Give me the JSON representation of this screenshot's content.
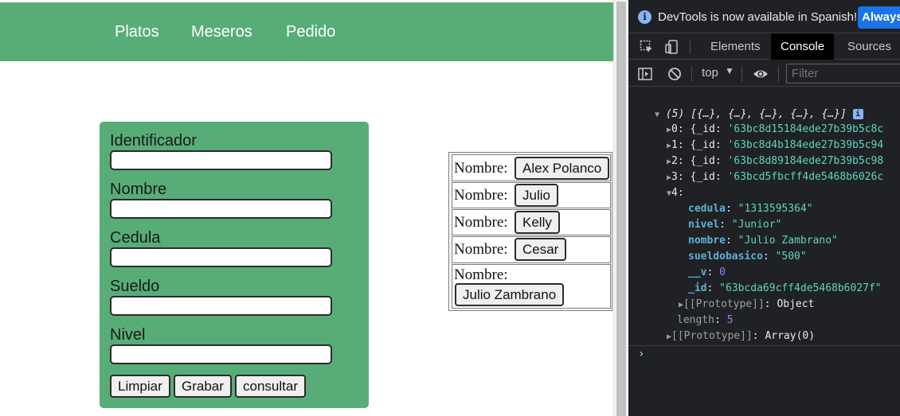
{
  "nav": {
    "platos": "Platos",
    "meseros": "Meseros",
    "pedido": "Pedido"
  },
  "form": {
    "fields": [
      {
        "label": "Identificador",
        "value": ""
      },
      {
        "label": "Nombre",
        "value": ""
      },
      {
        "label": "Cedula",
        "value": ""
      },
      {
        "label": "Sueldo",
        "value": ""
      },
      {
        "label": "Nivel",
        "value": ""
      }
    ],
    "buttons": {
      "clear": "Limpiar",
      "save": "Grabar",
      "query": "consultar"
    }
  },
  "names_table": {
    "row_label": "Nombre:",
    "rows": [
      "Alex Polanco",
      "Julio",
      "Kelly",
      "Cesar",
      "Julio Zambrano"
    ]
  },
  "devtools": {
    "info_text": "DevTools is now available in Spanish!",
    "always_button": "Always",
    "tabs": [
      "Elements",
      "Console",
      "Sources"
    ],
    "active_tab": "Console",
    "context": "top",
    "filter_placeholder": "Filter",
    "console": {
      "array_summary": "(5) [{…}, {…}, {…}, {…}, {…}]",
      "info_badge": "i",
      "items": [
        {
          "index": "0:",
          "preview": "{_id: ",
          "id": "'63bc8d15184ede27b39b5c8c"
        },
        {
          "index": "1:",
          "preview": "{_id: ",
          "id": "'63bc8d4b184ede27b39b5c94"
        },
        {
          "index": "2:",
          "preview": "{_id: ",
          "id": "'63bc8d89184ede27b39b5c98"
        },
        {
          "index": "3:",
          "preview": "{_id: ",
          "id": "'63bcd5fbcff4de5468b6026c"
        }
      ],
      "expanded_index": "4:",
      "expanded_props": [
        {
          "key": "cedula",
          "value": "\"1313595364\"",
          "kind": "str"
        },
        {
          "key": "nivel",
          "value": "\"Junior\"",
          "kind": "str"
        },
        {
          "key": "nombre",
          "value": "\"Julio Zambrano\"",
          "kind": "str"
        },
        {
          "key": "sueldobasico",
          "value": "\"500\"",
          "kind": "str"
        },
        {
          "key": "__v",
          "value": "0",
          "kind": "num"
        },
        {
          "key": "_id",
          "value": "\"63bcda69cff4de5468b6027f\"",
          "kind": "str"
        }
      ],
      "object_prototype_key": "[[Prototype]]",
      "object_prototype_value": "Object",
      "length_key": "length",
      "length_value": "5",
      "array_prototype_key": "[[Prototype]]",
      "array_prototype_value": "Array(0)",
      "prompt": "›"
    }
  },
  "colors": {
    "accent_green": "#58ad77",
    "devtools_bg": "#202124",
    "devtools_button": "#1a73e8"
  }
}
